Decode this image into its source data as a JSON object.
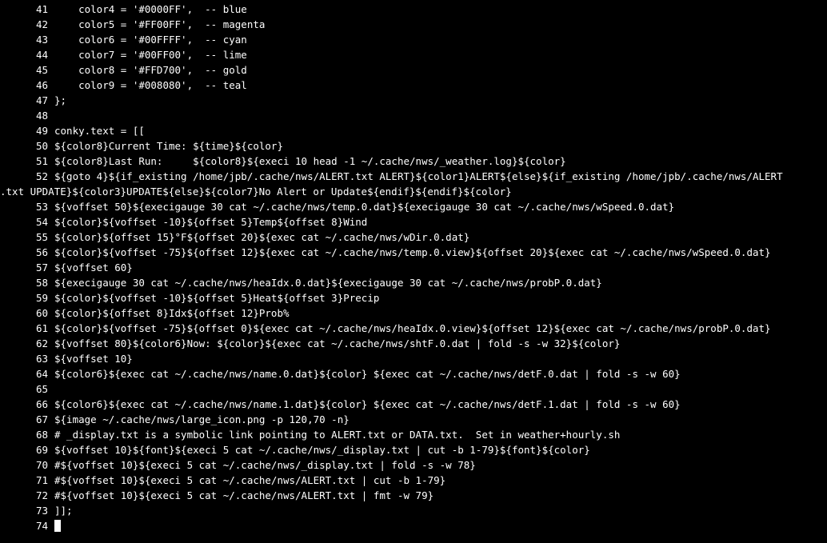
{
  "lines": [
    {
      "n": "41",
      "t": "    color4 = '#0000FF',  -- blue"
    },
    {
      "n": "42",
      "t": "    color5 = '#FF00FF',  -- magenta"
    },
    {
      "n": "43",
      "t": "    color6 = '#00FFFF',  -- cyan"
    },
    {
      "n": "44",
      "t": "    color7 = '#00FF00',  -- lime"
    },
    {
      "n": "45",
      "t": "    color8 = '#FFD700',  -- gold"
    },
    {
      "n": "46",
      "t": "    color9 = '#008080',  -- teal"
    },
    {
      "n": "47",
      "t": "};"
    },
    {
      "n": "48",
      "t": ""
    },
    {
      "n": "49",
      "t": "conky.text = [["
    },
    {
      "n": "50",
      "t": "${color8}Current Time: ${time}${color}"
    },
    {
      "n": "51",
      "t": "${color8}Last Run:     ${color8}${execi 10 head -1 ~/.cache/nws/_weather.log}${color}"
    },
    {
      "n": "52",
      "t": "${goto 4}${if_existing /home/jpb/.cache/nws/ALERT.txt ALERT}${color1}ALERT${else}${if_existing /home/jpb/.cache/nws/ALERT",
      "wrap": ".txt UPDATE}${color3}UPDATE${else}${color7}No Alert or Update${endif}${endif}${color}"
    },
    {
      "n": "53",
      "t": "${voffset 50}${execigauge 30 cat ~/.cache/nws/temp.0.dat}${execigauge 30 cat ~/.cache/nws/wSpeed.0.dat}"
    },
    {
      "n": "54",
      "t": "${color}${voffset -10}${offset 5}Temp${offset 8}Wind"
    },
    {
      "n": "55",
      "t": "${color}${offset 15}°F${offset 20}${exec cat ~/.cache/nws/wDir.0.dat}"
    },
    {
      "n": "56",
      "t": "${color}${voffset -75}${offset 12}${exec cat ~/.cache/nws/temp.0.view}${offset 20}${exec cat ~/.cache/nws/wSpeed.0.dat}"
    },
    {
      "n": "57",
      "t": "${voffset 60}"
    },
    {
      "n": "58",
      "t": "${execigauge 30 cat ~/.cache/nws/heaIdx.0.dat}${execigauge 30 cat ~/.cache/nws/probP.0.dat}"
    },
    {
      "n": "59",
      "t": "${color}${voffset -10}${offset 5}Heat${offset 3}Precip"
    },
    {
      "n": "60",
      "t": "${color}${offset 8}Idx${offset 12}Prob%"
    },
    {
      "n": "61",
      "t": "${color}${voffset -75}${offset 0}${exec cat ~/.cache/nws/heaIdx.0.view}${offset 12}${exec cat ~/.cache/nws/probP.0.dat}"
    },
    {
      "n": "62",
      "t": "${voffset 80}${color6}Now: ${color}${exec cat ~/.cache/nws/shtF.0.dat | fold -s -w 32}${color}"
    },
    {
      "n": "63",
      "t": "${voffset 10}"
    },
    {
      "n": "64",
      "t": "${color6}${exec cat ~/.cache/nws/name.0.dat}${color} ${exec cat ~/.cache/nws/detF.0.dat | fold -s -w 60}"
    },
    {
      "n": "65",
      "t": ""
    },
    {
      "n": "66",
      "t": "${color6}${exec cat ~/.cache/nws/name.1.dat}${color} ${exec cat ~/.cache/nws/detF.1.dat | fold -s -w 60}"
    },
    {
      "n": "67",
      "t": "${image ~/.cache/nws/large_icon.png -p 120,70 -n}"
    },
    {
      "n": "68",
      "t": "# _display.txt is a symbolic link pointing to ALERT.txt or DATA.txt.  Set in weather+hourly.sh"
    },
    {
      "n": "69",
      "t": "${voffset 10}${font}${execi 5 cat ~/.cache/nws/_display.txt | cut -b 1-79}${font}${color}"
    },
    {
      "n": "70",
      "t": "#${voffset 10}${execi 5 cat ~/.cache/nws/_display.txt | fold -s -w 78}"
    },
    {
      "n": "71",
      "t": "#${voffset 10}${execi 5 cat ~/.cache/nws/ALERT.txt | cut -b 1-79}"
    },
    {
      "n": "72",
      "t": "#${voffset 10}${execi 5 cat ~/.cache/nws/ALERT.txt | fmt -w 79}"
    },
    {
      "n": "73",
      "t": "]];"
    },
    {
      "n": "74",
      "t": "",
      "cursor": true
    }
  ]
}
